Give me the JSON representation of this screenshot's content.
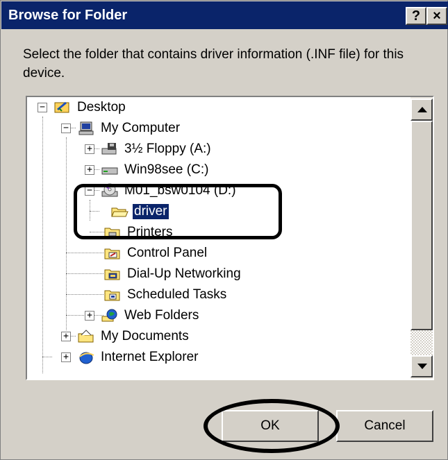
{
  "window": {
    "title": "Browse for Folder",
    "help_label": "?",
    "close_label": "×"
  },
  "prompt": "Select the folder that contains driver information (.INF file) for this device.",
  "tree": {
    "items": [
      {
        "label": "Desktop",
        "icon": "desktop-icon",
        "expander": "−"
      },
      {
        "label": "My Computer",
        "icon": "my-computer-icon",
        "expander": "−"
      },
      {
        "label": "3½ Floppy (A:)",
        "icon": "floppy-drive-icon",
        "expander": "+"
      },
      {
        "label": "Win98see (C:)",
        "icon": "hard-drive-icon",
        "expander": "+"
      },
      {
        "label": "M01_bsw0104 (D:)",
        "icon": "cd-drive-icon",
        "expander": "−"
      },
      {
        "label": "driver",
        "icon": "folder-open-icon",
        "selected": true
      },
      {
        "label": "Printers",
        "icon": "printers-folder-icon"
      },
      {
        "label": "Control Panel",
        "icon": "control-panel-icon"
      },
      {
        "label": "Dial-Up Networking",
        "icon": "dialup-networking-icon"
      },
      {
        "label": "Scheduled Tasks",
        "icon": "scheduled-tasks-icon"
      },
      {
        "label": "Web Folders",
        "icon": "web-folders-icon",
        "expander": "+"
      },
      {
        "label": "My Documents",
        "icon": "my-documents-icon",
        "expander": "+"
      },
      {
        "label": "Internet Explorer",
        "icon": "internet-explorer-icon",
        "expander": "+"
      }
    ]
  },
  "buttons": {
    "ok": "OK",
    "cancel": "Cancel"
  },
  "colors": {
    "titlebar": "#0a246a",
    "face": "#d4d0c8",
    "selection": "#0a246a"
  }
}
